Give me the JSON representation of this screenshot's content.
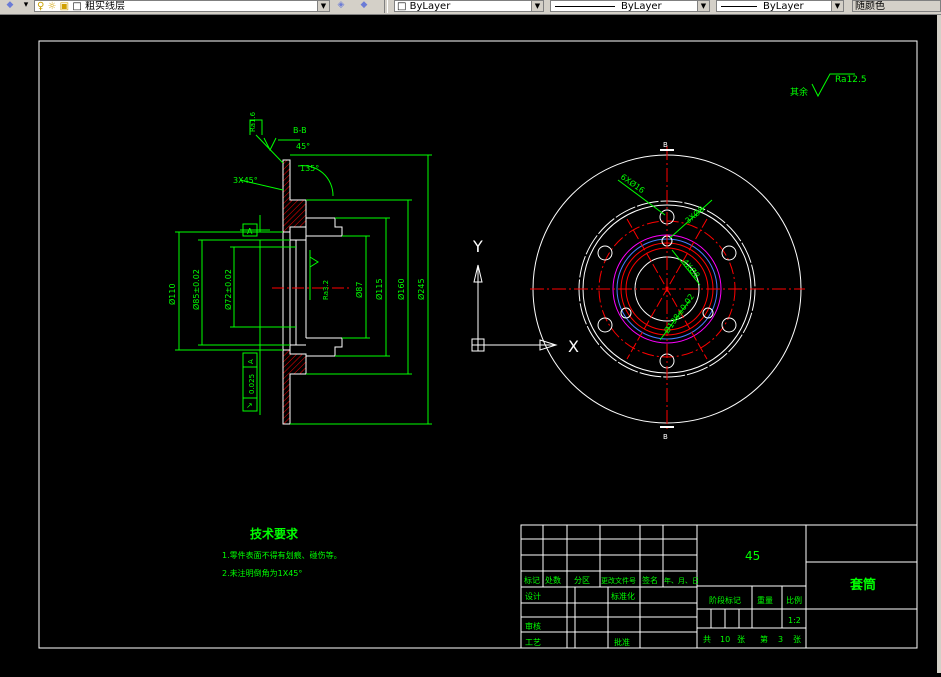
{
  "toolbar": {
    "layer_name": "粗实线层",
    "color_value": "ByLayer",
    "linetype_value": "ByLayer",
    "lineweight_value": "ByLayer",
    "plotstyle_value": "随颜色"
  },
  "drawing": {
    "surface_roughness_prefix": "其余",
    "surface_roughness_value": "Ra12.5",
    "section_label": "B-B",
    "chamfer_angle": "45°",
    "angle_135": "135°",
    "chamfer_3x45": "3X45°",
    "ra16": "Ra1.6",
    "ra32": "Ra3.2",
    "datum_a": "A",
    "tol_symbol": "↗",
    "tol_value": "0.025",
    "tol_datum": "A",
    "dims_left": [
      "Ø110",
      "Ø85±0.02",
      "Ø72±0.02"
    ],
    "dims_right": [
      "Ø87",
      "Ø115",
      "Ø160",
      "Ø245"
    ],
    "circle_dims": [
      "6XØ16",
      "3XØ8",
      "4XØ8",
      "Ø138±0.02"
    ],
    "section_mark_top": "B",
    "section_mark_bottom": "B",
    "ucs_y": "Y",
    "ucs_x": "X"
  },
  "tech_req": {
    "title": "技术要求",
    "line1": "1.零件表面不得有划痕、碰伤等。",
    "line2": "2.未注明倒角为1X45°"
  },
  "title_block": {
    "material": "45",
    "part_name": "套筒",
    "header_labels": [
      "标记",
      "处数",
      "分区",
      "更改文件号",
      "签名",
      "年、月、日"
    ],
    "row_design": "设计",
    "row_standard": "标准化",
    "row_review": "审核",
    "row_process": "工艺",
    "row_approve": "批准",
    "stage_label": "阶段标记",
    "weight_label": "重量",
    "scale_label": "比例",
    "scale_value": "1:2",
    "sheet_total_prefix": "共",
    "sheet_total": "10",
    "sheet_unit": "张",
    "sheet_no_prefix": "第",
    "sheet_no": "3",
    "sheet_no_unit": "张"
  },
  "colors": {
    "green": "#00ff00",
    "red": "#ff0000",
    "white": "#ffffff",
    "magenta": "#ff00ff",
    "blue": "#4a7cff"
  }
}
